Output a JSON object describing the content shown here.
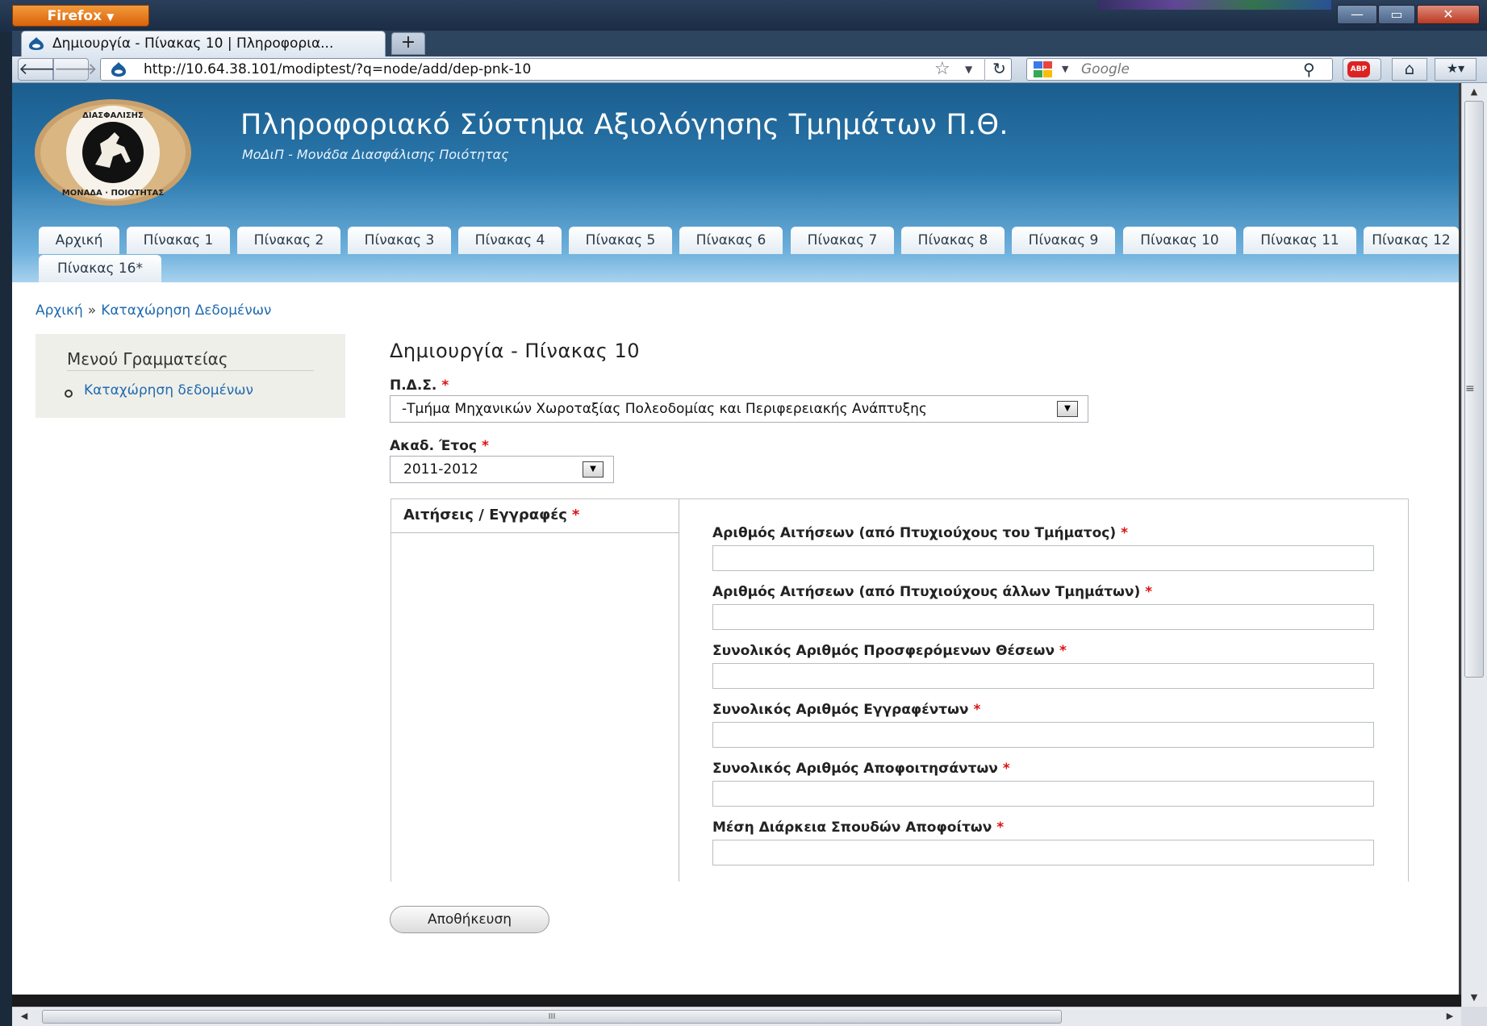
{
  "browser": {
    "app_button": "Firefox",
    "tab_title": "Δημιουργία - Πίνακας 10 | Πληροφορια...",
    "new_tab": "+",
    "url": "http://10.64.38.101/modiptest/?q=node/add/dep-pnk-10",
    "search_placeholder": "Google",
    "abp_label": "ABP",
    "window_controls": {
      "minimize": "—",
      "maximize": "▭",
      "close": "✕"
    },
    "icons": {
      "back": "back-arrow-icon",
      "forward": "forward-arrow-icon",
      "reload": "reload-icon",
      "bookmark_star": "star-icon",
      "search": "magnifier-icon",
      "home": "home-icon",
      "bookmarks": "bookmarks-icon"
    }
  },
  "site": {
    "name": "Πληροφοριακό Σύστημα Αξιολόγησης Τμημάτων Π.Θ.",
    "slogan": "ΜοΔιΠ - Μονάδα Διασφάλισης Ποιότητας",
    "logo_text": "ΜΟΝΑΔΑ ΔΙΑΣΦΑΛΙΣΗΣ ΠΟΙΟΤΗΤΑΣ",
    "tabs_row1": [
      "Αρχική",
      "Πίνακας 1",
      "Πίνακας 2",
      "Πίνακας 3",
      "Πίνακας 4",
      "Πίνακας 5",
      "Πίνακας 6",
      "Πίνακας 7",
      "Πίνακας 8",
      "Πίνακας 9",
      "Πίνακας 10",
      "Πίνακας 11",
      "Πίνακας 12"
    ],
    "tabs_row2": [
      "Πίνακας 16*"
    ]
  },
  "breadcrumb": {
    "home": "Αρχική",
    "separator": "»",
    "current": "Καταχώρηση Δεδομένων"
  },
  "sidebar": {
    "title": "Μενού Γραμματείας",
    "link": "Καταχώρηση δεδομένων"
  },
  "form": {
    "title": "Δημιουργία - Πίνακας 10",
    "required_mark": "*",
    "pds_label": "Π.Δ.Σ.",
    "pds_value": "-Τμήμα Μηχανικών Χωροταξίας Πολεοδομίας και Περιφερειακής Ανάπτυξης",
    "year_label": "Ακαδ. Έτος",
    "year_value": "2011-2012",
    "vtab_label": "Αιτήσεις / Εγγραφές",
    "fields": [
      {
        "label": "Αριθμός Αιτήσεων (από Πτυχιούχους του Τμήματος)",
        "value": ""
      },
      {
        "label": "Αριθμός Αιτήσεων (από Πτυχιούχους άλλων Τμημάτων)",
        "value": ""
      },
      {
        "label": "Συνολικός Αριθμός Προσφερόμενων Θέσεων",
        "value": ""
      },
      {
        "label": "Συνολικός Αριθμός Εγγραφέντων",
        "value": ""
      },
      {
        "label": "Συνολικός Αριθμός Αποφοιτησάντων",
        "value": ""
      },
      {
        "label": "Μέση Διάρκεια Σπουδών Αποφοίτων",
        "value": ""
      }
    ],
    "save_label": "Αποθήκευση"
  },
  "scrollbar": {
    "h_grip": "III"
  }
}
